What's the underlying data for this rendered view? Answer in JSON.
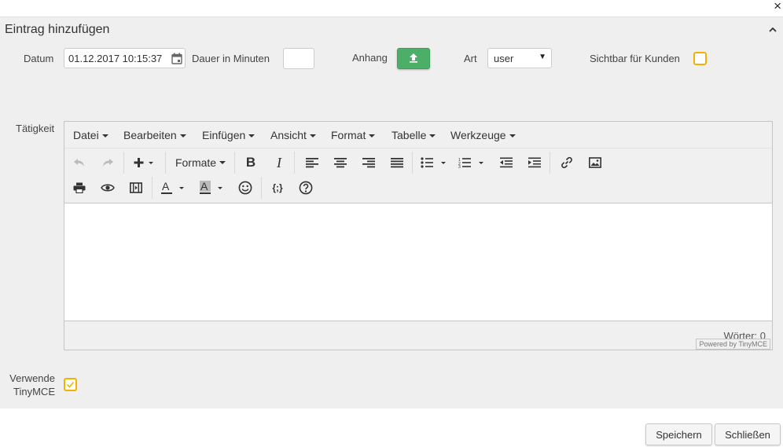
{
  "dialog": {
    "title": "Eintrag hinzufügen",
    "close_symbol": "×"
  },
  "form": {
    "date_label": "Datum",
    "date_value": "01.12.2017 10:15:37",
    "duration_label": "Dauer in Minuten",
    "duration_value": "",
    "attachment_label": "Anhang",
    "type_label": "Art",
    "type_value": "user",
    "visible_label": "Sichtbar für Kunden",
    "visible_checked": false,
    "activity_label": "Tätigkeit",
    "use_tinymce_label_1": "Verwende",
    "use_tinymce_label_2": "TinyMCE",
    "use_tinymce_checked": true
  },
  "editor": {
    "menus": [
      "Datei",
      "Bearbeiten",
      "Einfügen",
      "Ansicht",
      "Format",
      "Tabelle",
      "Werkzeuge"
    ],
    "formats_label": "Formate",
    "word_count": "Wörter: 0",
    "branding": "Powered by TinyMCE",
    "toolbar_icons": [
      "undo-icon",
      "redo-icon",
      "insert-icon",
      "bold-icon",
      "italic-icon",
      "align-left-icon",
      "align-center-icon",
      "align-right-icon",
      "align-justify-icon",
      "bullet-list-icon",
      "numbered-list-icon",
      "outdent-icon",
      "indent-icon",
      "link-icon",
      "image-icon",
      "print-icon",
      "preview-icon",
      "media-icon",
      "text-color-icon",
      "background-color-icon",
      "emoticons-icon",
      "code-sample-icon",
      "help-icon"
    ]
  },
  "footer": {
    "save_label": "Speichern",
    "close_label": "Schließen"
  },
  "colors": {
    "upload_button": "#4caf68",
    "checkbox_border": "#f0b400",
    "panel_bg": "#efefef"
  }
}
